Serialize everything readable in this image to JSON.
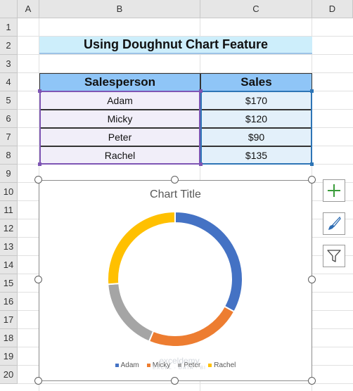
{
  "grid": {
    "columns": [
      "A",
      "B",
      "C",
      "D"
    ],
    "rows": [
      "1",
      "2",
      "3",
      "4",
      "5",
      "6",
      "7",
      "8",
      "9",
      "10",
      "11",
      "12",
      "13",
      "14",
      "15",
      "16",
      "17",
      "18",
      "19",
      "20"
    ]
  },
  "title": "Using Doughnut Chart Feature",
  "table": {
    "headers": [
      "Salesperson",
      "Sales"
    ],
    "rows": [
      {
        "name": "Adam",
        "sales": "$170"
      },
      {
        "name": "Micky",
        "sales": "$120"
      },
      {
        "name": "Peter",
        "sales": "$90"
      },
      {
        "name": "Rachel",
        "sales": "$135"
      }
    ]
  },
  "chart_data": {
    "type": "doughnut",
    "title": "Chart Title",
    "categories": [
      "Adam",
      "Micky",
      "Peter",
      "Rachel"
    ],
    "values": [
      170,
      120,
      90,
      135
    ],
    "colors": [
      "#4472c4",
      "#ed7d31",
      "#a5a5a5",
      "#ffc000"
    ],
    "legend_position": "bottom"
  },
  "chart_tools": {
    "elements_icon": "plus-icon",
    "styles_icon": "brush-icon",
    "filters_icon": "filter-icon"
  },
  "watermark": {
    "name": "exceldemy",
    "tagline": "EXCEL · DATA · BI"
  }
}
